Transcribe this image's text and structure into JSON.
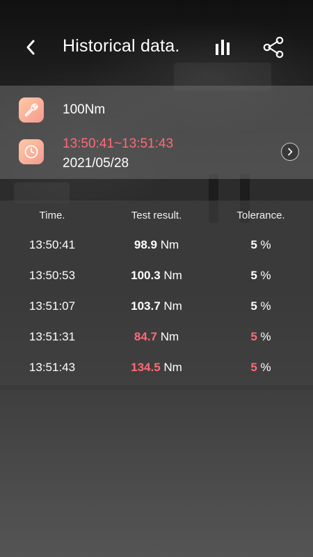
{
  "header": {
    "title": "Historical data.",
    "back_icon": "chevron-left-icon",
    "chart_icon": "bar-chart-icon",
    "share_icon": "share-icon"
  },
  "info": {
    "torque_icon": "wrench-icon",
    "torque_value": "100Nm",
    "clock_icon": "clock-icon",
    "time_range": "13:50:41~13:51:43",
    "date": "2021/05/28",
    "next_icon": "chevron-right-icon"
  },
  "colors": {
    "alert": "#ff6a77",
    "icon_tile_start": "#ffc9a6",
    "icon_tile_end": "#f59a8e"
  },
  "table": {
    "headers": {
      "time": "Time.",
      "result": "Test result.",
      "tolerance": "Tolerance."
    },
    "rows": [
      {
        "time": "13:50:41",
        "value": "98.9",
        "unit": "Nm",
        "tolerance": "5",
        "tol_unit": "%",
        "out_of_range": false
      },
      {
        "time": "13:50:53",
        "value": "100.3",
        "unit": "Nm",
        "tolerance": "5",
        "tol_unit": "%",
        "out_of_range": false
      },
      {
        "time": "13:51:07",
        "value": "103.7",
        "unit": "Nm",
        "tolerance": "5",
        "tol_unit": "%",
        "out_of_range": false
      },
      {
        "time": "13:51:31",
        "value": "84.7",
        "unit": "Nm",
        "tolerance": "5",
        "tol_unit": "%",
        "out_of_range": true
      },
      {
        "time": "13:51:43",
        "value": "134.5",
        "unit": "Nm",
        "tolerance": "5",
        "tol_unit": "%",
        "out_of_range": true
      }
    ]
  }
}
